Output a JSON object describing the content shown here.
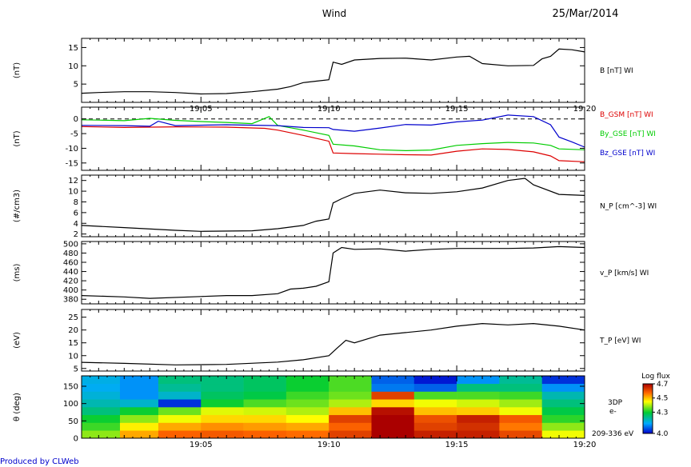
{
  "header": {
    "mission": "Wind",
    "date": "25/Mar/2014"
  },
  "footer": {
    "credit": "Produced by CLWeb"
  },
  "colors": {
    "black": "#000000",
    "red": "#dd0000",
    "green": "#00cc00",
    "blue": "#0000cc"
  },
  "chart_data": [
    {
      "type": "line",
      "ylabel": "(nT)",
      "ylim": [
        0,
        17.5
      ],
      "yticks": [
        5,
        10,
        15
      ],
      "xlim": [
        "19:00:20",
        "19:20:00"
      ],
      "xticks": [
        "19:05",
        "19:10",
        "19:15",
        "19:20"
      ],
      "series": [
        {
          "name": "B [nT] WI",
          "color": "#000000",
          "points": [
            [
              "19:00:20",
              2.5
            ],
            [
              "19:01:00",
              2.7
            ],
            [
              "19:02:00",
              2.9
            ],
            [
              "19:03:00",
              2.9
            ],
            [
              "19:04:00",
              2.7
            ],
            [
              "19:05:00",
              2.3
            ],
            [
              "19:06:00",
              2.4
            ],
            [
              "19:07:00",
              2.9
            ],
            [
              "19:08:00",
              3.6
            ],
            [
              "19:08:30",
              4.3
            ],
            [
              "19:09:00",
              5.4
            ],
            [
              "19:09:30",
              5.8
            ],
            [
              "19:10:00",
              6.2
            ],
            [
              "19:10:10",
              11.0
            ],
            [
              "19:10:30",
              10.4
            ],
            [
              "19:11:00",
              11.6
            ],
            [
              "19:12:00",
              12.0
            ],
            [
              "19:13:00",
              12.1
            ],
            [
              "19:14:00",
              11.6
            ],
            [
              "19:15:00",
              12.4
            ],
            [
              "19:15:30",
              12.6
            ],
            [
              "19:16:00",
              10.6
            ],
            [
              "19:17:00",
              10.0
            ],
            [
              "19:18:00",
              10.1
            ],
            [
              "19:18:20",
              11.9
            ],
            [
              "19:18:40",
              12.6
            ],
            [
              "19:19:00",
              14.6
            ],
            [
              "19:19:30",
              14.4
            ],
            [
              "19:20:00",
              13.8
            ]
          ]
        }
      ]
    },
    {
      "type": "line",
      "ylabel": "(nT)",
      "ylim": [
        -17.5,
        4
      ],
      "yticks": [
        0,
        -5,
        -10,
        -15
      ],
      "reference_line": 0,
      "xlim": [
        "19:00:20",
        "19:20:00"
      ],
      "series": [
        {
          "name": "B_GSM [nT] WI",
          "color": "#dd0000",
          "points": [
            [
              "19:00:20",
              -2.6
            ],
            [
              "19:02:00",
              -2.9
            ],
            [
              "19:04:00",
              -2.7
            ],
            [
              "19:06:00",
              -2.8
            ],
            [
              "19:07:30",
              -3.2
            ],
            [
              "19:08:00",
              -3.8
            ],
            [
              "19:09:00",
              -5.6
            ],
            [
              "19:10:00",
              -7.6
            ],
            [
              "19:10:10",
              -11.6
            ],
            [
              "19:11:00",
              -11.8
            ],
            [
              "19:12:00",
              -12.0
            ],
            [
              "19:13:00",
              -12.2
            ],
            [
              "19:14:00",
              -12.3
            ],
            [
              "19:15:00",
              -11.0
            ],
            [
              "19:16:00",
              -10.2
            ],
            [
              "19:17:00",
              -10.4
            ],
            [
              "19:18:00",
              -11.2
            ],
            [
              "19:18:40",
              -12.6
            ],
            [
              "19:19:00",
              -14.2
            ],
            [
              "19:20:00",
              -14.6
            ]
          ]
        },
        {
          "name": "By_GSE [nT] WI",
          "color": "#00cc00",
          "points": [
            [
              "19:00:20",
              -0.3
            ],
            [
              "19:01:00",
              -0.4
            ],
            [
              "19:02:00",
              -0.6
            ],
            [
              "19:03:00",
              0.2
            ],
            [
              "19:04:00",
              -0.5
            ],
            [
              "19:05:00",
              -0.9
            ],
            [
              "19:06:00",
              -1.2
            ],
            [
              "19:07:00",
              -1.6
            ],
            [
              "19:07:40",
              0.8
            ],
            [
              "19:08:00",
              -2.2
            ],
            [
              "19:09:00",
              -3.8
            ],
            [
              "19:10:00",
              -5.6
            ],
            [
              "19:10:10",
              -8.6
            ],
            [
              "19:11:00",
              -9.2
            ],
            [
              "19:12:00",
              -10.5
            ],
            [
              "19:13:00",
              -10.8
            ],
            [
              "19:14:00",
              -10.6
            ],
            [
              "19:15:00",
              -9.0
            ],
            [
              "19:16:00",
              -8.4
            ],
            [
              "19:17:00",
              -8.0
            ],
            [
              "19:18:00",
              -8.2
            ],
            [
              "19:18:40",
              -9.0
            ],
            [
              "19:19:00",
              -10.2
            ],
            [
              "19:20:00",
              -10.5
            ]
          ]
        },
        {
          "name": "Bz_GSE [nT] WI",
          "color": "#0000cc",
          "points": [
            [
              "19:00:20",
              -2.2
            ],
            [
              "19:02:00",
              -2.3
            ],
            [
              "19:03:00",
              -2.5
            ],
            [
              "19:03:20",
              -0.8
            ],
            [
              "19:04:00",
              -2.3
            ],
            [
              "19:06:00",
              -2.0
            ],
            [
              "19:08:00",
              -2.3
            ],
            [
              "19:09:00",
              -2.9
            ],
            [
              "19:10:00",
              -3.0
            ],
            [
              "19:10:10",
              -3.6
            ],
            [
              "19:11:00",
              -4.2
            ],
            [
              "19:12:00",
              -3.1
            ],
            [
              "19:13:00",
              -1.9
            ],
            [
              "19:14:00",
              -2.1
            ],
            [
              "19:15:00",
              -1.0
            ],
            [
              "19:16:00",
              -0.4
            ],
            [
              "19:17:00",
              1.3
            ],
            [
              "19:18:00",
              0.8
            ],
            [
              "19:18:40",
              -2.0
            ],
            [
              "19:19:00",
              -6.2
            ],
            [
              "19:19:30",
              -7.8
            ],
            [
              "19:20:00",
              -9.6
            ]
          ]
        }
      ]
    },
    {
      "type": "line",
      "ylabel": "(#/cm3)",
      "ylim": [
        1.5,
        13
      ],
      "yticks": [
        2,
        4,
        6,
        8,
        10,
        12
      ],
      "xlim": [
        "19:00:20",
        "19:20:00"
      ],
      "series": [
        {
          "name": "N_P [cm^-3] WI",
          "color": "#000000",
          "points": [
            [
              "19:00:20",
              3.6
            ],
            [
              "19:02:00",
              3.2
            ],
            [
              "19:04:00",
              2.7
            ],
            [
              "19:05:00",
              2.5
            ],
            [
              "19:07:00",
              2.6
            ],
            [
              "19:08:00",
              3.0
            ],
            [
              "19:09:00",
              3.6
            ],
            [
              "19:09:30",
              4.4
            ],
            [
              "19:10:00",
              4.8
            ],
            [
              "19:10:10",
              7.8
            ],
            [
              "19:10:30",
              8.6
            ],
            [
              "19:11:00",
              9.6
            ],
            [
              "19:12:00",
              10.2
            ],
            [
              "19:13:00",
              9.7
            ],
            [
              "19:14:00",
              9.6
            ],
            [
              "19:15:00",
              9.9
            ],
            [
              "19:16:00",
              10.6
            ],
            [
              "19:17:00",
              12.0
            ],
            [
              "19:17:40",
              12.4
            ],
            [
              "19:18:00",
              11.2
            ],
            [
              "19:19:00",
              9.4
            ],
            [
              "19:20:00",
              9.2
            ]
          ]
        }
      ]
    },
    {
      "type": "line",
      "ylabel": "(ms)",
      "ylim": [
        370,
        505
      ],
      "yticks": [
        380,
        400,
        420,
        440,
        460,
        480,
        500
      ],
      "xlim": [
        "19:00:20",
        "19:20:00"
      ],
      "series": [
        {
          "name": "v_P [km/s] WI",
          "color": "#000000",
          "points": [
            [
              "19:00:20",
              388
            ],
            [
              "19:02:00",
              385
            ],
            [
              "19:03:00",
              382
            ],
            [
              "19:05:00",
              386
            ],
            [
              "19:06:00",
              388
            ],
            [
              "19:07:00",
              388
            ],
            [
              "19:08:00",
              392
            ],
            [
              "19:08:30",
              402
            ],
            [
              "19:09:00",
              404
            ],
            [
              "19:09:30",
              408
            ],
            [
              "19:10:00",
              418
            ],
            [
              "19:10:10",
              480
            ],
            [
              "19:10:30",
              492
            ],
            [
              "19:11:00",
              488
            ],
            [
              "19:12:00",
              489
            ],
            [
              "19:13:00",
              484
            ],
            [
              "19:14:00",
              488
            ],
            [
              "19:15:00",
              490
            ],
            [
              "19:16:00",
              490
            ],
            [
              "19:17:00",
              490
            ],
            [
              "19:18:00",
              491
            ],
            [
              "19:19:00",
              494
            ],
            [
              "19:20:00",
              492
            ]
          ]
        }
      ]
    },
    {
      "type": "line",
      "ylabel": "(eV)",
      "ylim": [
        4,
        28
      ],
      "yticks": [
        5,
        10,
        15,
        20,
        25
      ],
      "xlim": [
        "19:00:20",
        "19:20:00"
      ],
      "series": [
        {
          "name": "T_P [eV] WI",
          "color": "#000000",
          "points": [
            [
              "19:00:20",
              7.4
            ],
            [
              "19:02:00",
              7.0
            ],
            [
              "19:04:00",
              6.4
            ],
            [
              "19:06:00",
              6.6
            ],
            [
              "19:08:00",
              7.5
            ],
            [
              "19:09:00",
              8.4
            ],
            [
              "19:10:00",
              10.0
            ],
            [
              "19:10:20",
              13.0
            ],
            [
              "19:10:40",
              16.0
            ],
            [
              "19:11:00",
              15.0
            ],
            [
              "19:12:00",
              18.0
            ],
            [
              "19:13:00",
              19.0
            ],
            [
              "19:14:00",
              20.0
            ],
            [
              "19:15:00",
              21.5
            ],
            [
              "19:16:00",
              22.5
            ],
            [
              "19:17:00",
              22.0
            ],
            [
              "19:18:00",
              22.5
            ],
            [
              "19:19:00",
              21.5
            ],
            [
              "19:20:00",
              20.0
            ]
          ]
        }
      ]
    },
    {
      "type": "heatmap",
      "ylabel": "θ (deg)",
      "ylim": [
        0,
        180
      ],
      "yticks": [
        0,
        50,
        100,
        150
      ],
      "xlim": [
        "19:00:20",
        "19:20:00"
      ],
      "xticks": [
        "19:05",
        "19:10",
        "19:15",
        "19:20"
      ],
      "time_bins": [
        "19:00:20",
        "19:01:50",
        "19:03:20",
        "19:05:00",
        "19:06:40",
        "19:08:20",
        "19:10:00",
        "19:11:40",
        "19:13:20",
        "19:15:00",
        "19:16:40",
        "19:18:20",
        "19:20:00"
      ],
      "angle_bins": [
        0,
        22.5,
        45,
        67.5,
        90,
        112.5,
        135,
        157.5,
        180
      ],
      "values": [
        [
          4.38,
          4.52,
          4.58,
          4.59,
          4.58,
          4.57,
          4.62,
          4.7,
          4.66,
          4.66,
          4.61,
          4.44
        ],
        [
          4.33,
          4.46,
          4.52,
          4.54,
          4.53,
          4.52,
          4.58,
          4.7,
          4.62,
          4.64,
          4.56,
          4.38
        ],
        [
          4.3,
          4.38,
          4.44,
          4.48,
          4.48,
          4.45,
          4.62,
          4.7,
          4.6,
          4.66,
          4.59,
          4.32
        ],
        [
          4.24,
          4.3,
          4.36,
          4.43,
          4.42,
          4.4,
          4.5,
          4.68,
          4.5,
          4.49,
          4.44,
          4.28
        ],
        [
          4.2,
          4.18,
          4.04,
          4.3,
          4.34,
          4.36,
          4.4,
          4.48,
          4.44,
          4.42,
          4.39,
          4.24
        ],
        [
          4.17,
          4.12,
          4.18,
          4.26,
          4.28,
          4.33,
          4.36,
          4.62,
          4.34,
          4.34,
          4.33,
          4.2
        ],
        [
          4.15,
          4.12,
          4.22,
          4.24,
          4.26,
          4.3,
          4.34,
          4.1,
          4.08,
          4.24,
          4.24,
          4.12
        ],
        [
          4.16,
          4.12,
          4.24,
          4.24,
          4.26,
          4.3,
          4.34,
          4.08,
          4.02,
          4.12,
          4.22,
          4.04
        ]
      ],
      "colorbar": {
        "label": "Log flux",
        "range": [
          4.0,
          4.7
        ],
        "ticks": [
          4.0,
          4.3,
          4.5,
          4.7
        ]
      },
      "annotations": [
        "3DP",
        "e-",
        "209-336 eV"
      ]
    }
  ]
}
